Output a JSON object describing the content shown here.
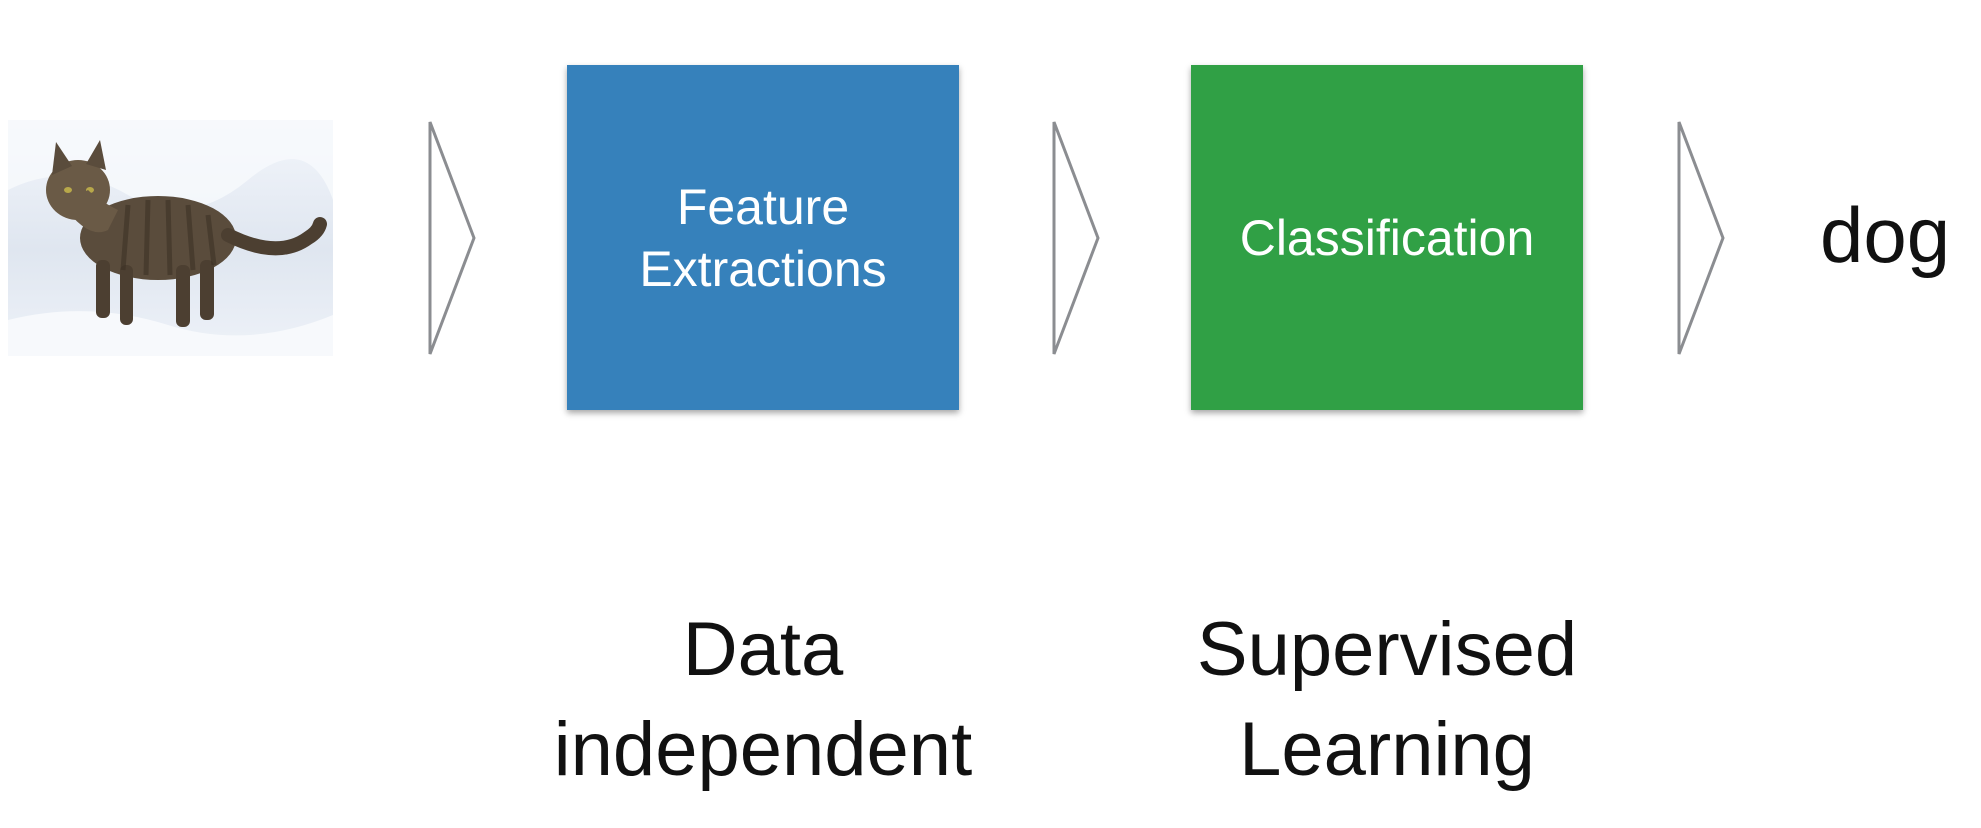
{
  "input_image": {
    "icon": "cat-photo",
    "snow_color": "#e9eef6",
    "cat_color": "#5a4c3c"
  },
  "steps": [
    {
      "label": "Feature\nExtractions",
      "color": "#3681bb",
      "caption": "Data\nindependent"
    },
    {
      "label": "Classification",
      "color": "#30a045",
      "caption": "Supervised\nLearning"
    }
  ],
  "arrow": {
    "icon": "chevron-right-icon",
    "color": "#8b8d91"
  },
  "output": {
    "label": "dog"
  }
}
